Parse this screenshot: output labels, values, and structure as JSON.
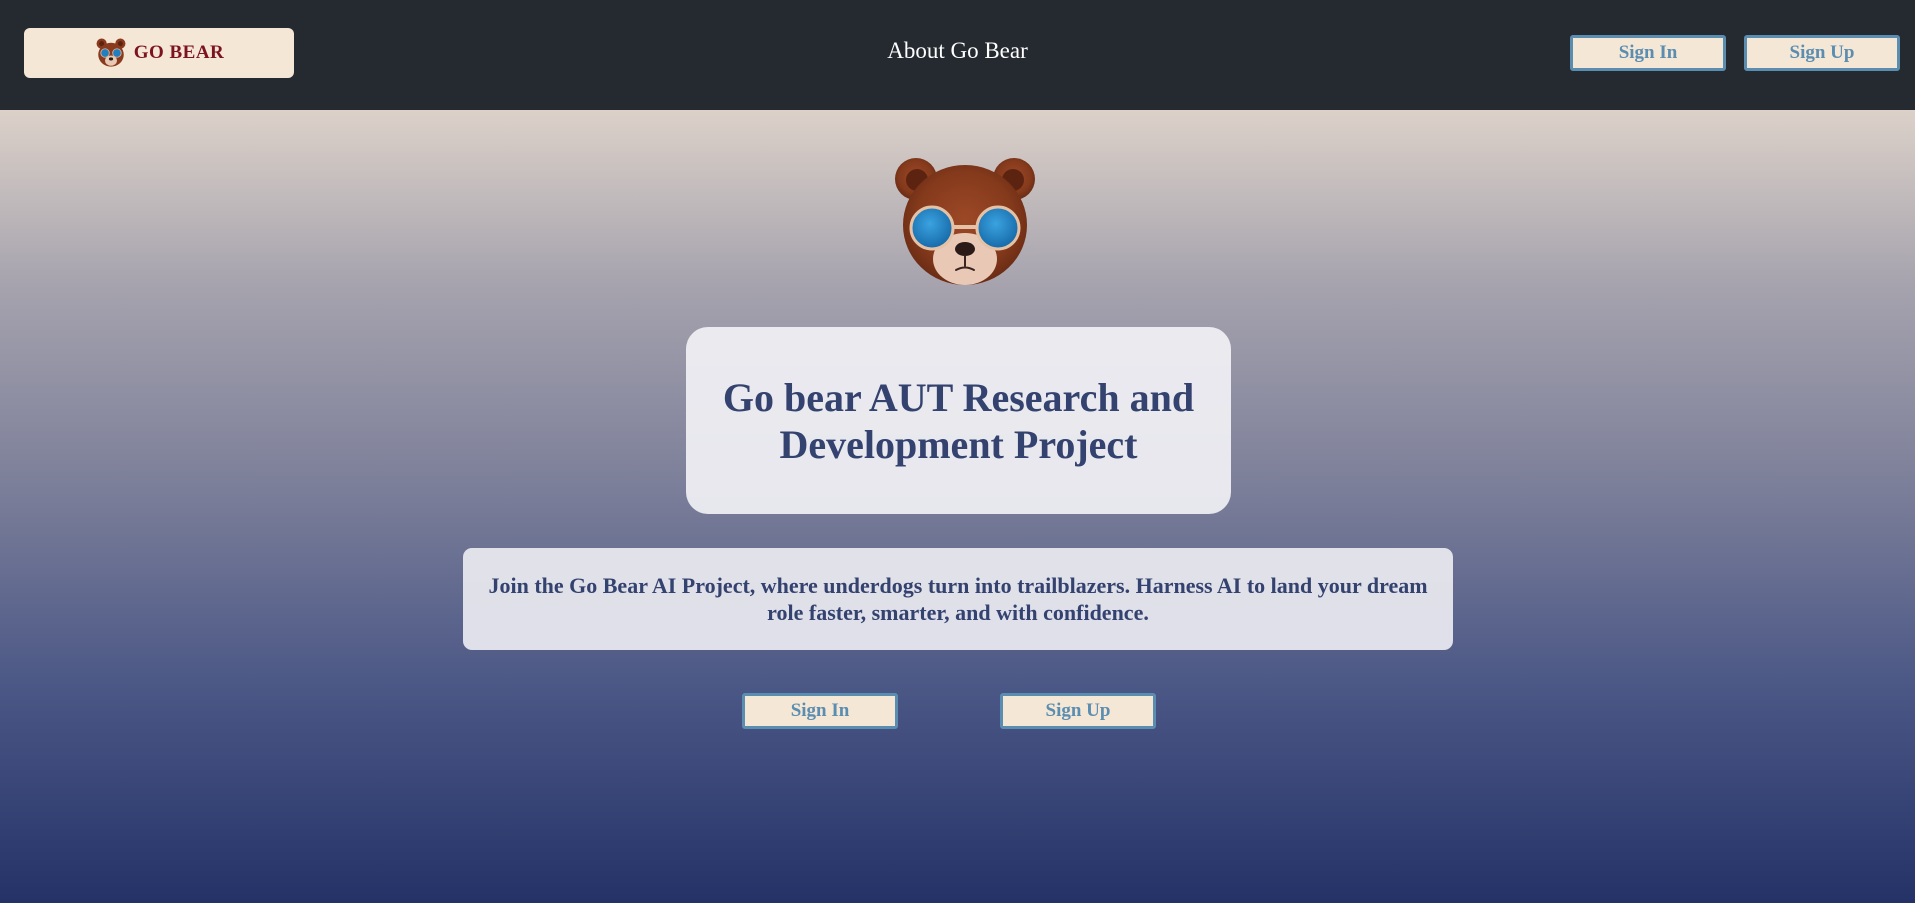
{
  "header": {
    "logo_text": "GO BEAR",
    "nav_link": "About Go Bear",
    "sign_in_label": "Sign In",
    "sign_up_label": "Sign Up"
  },
  "hero": {
    "title": "Go bear AUT Research and Development Project",
    "description": "Join the Go Bear AI Project, where underdogs turn into trailblazers. Harness AI to land your dream role faster, smarter, and with confidence.",
    "sign_in_label": "Sign In",
    "sign_up_label": "Sign Up"
  },
  "colors": {
    "header_bg": "#252a30",
    "button_bg": "#f5e7d6",
    "button_text": "#5b8db0",
    "title_text": "#34426f",
    "logo_text": "#7d1320"
  },
  "icons": {
    "logo": "bear-logo-icon",
    "hero": "bear-mascot-icon"
  }
}
